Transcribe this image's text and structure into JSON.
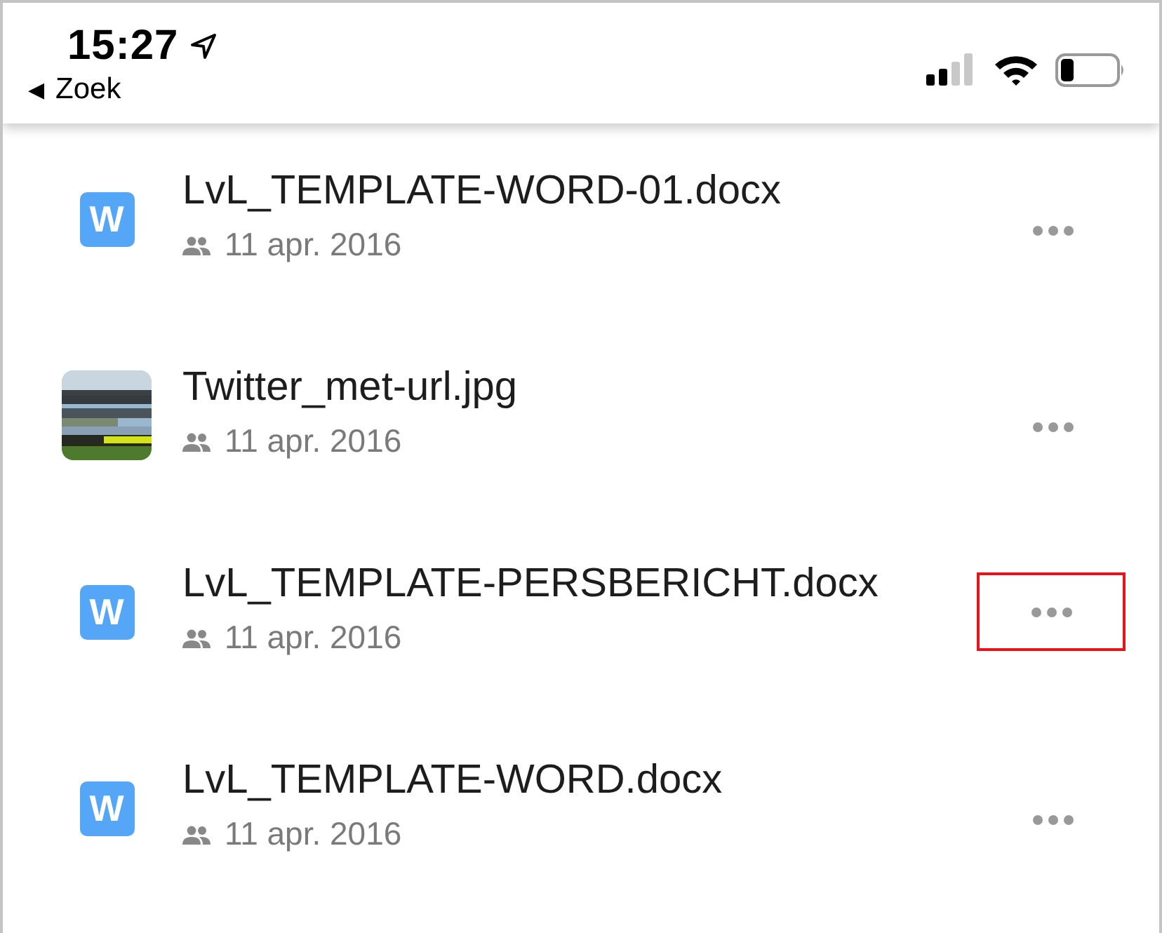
{
  "status_bar": {
    "time": "15:27",
    "back_label": "Zoek",
    "location_on": true,
    "back_arrow": "◀"
  },
  "files": [
    {
      "kind": "word",
      "icon_letter": "W",
      "name": "LvL_TEMPLATE-WORD-01.docx",
      "date": "11 apr. 2016",
      "shared": true,
      "highlighted": false
    },
    {
      "kind": "picture",
      "name": "Twitter_met-url.jpg",
      "date": "11 apr. 2016",
      "shared": true,
      "highlighted": false
    },
    {
      "kind": "word",
      "icon_letter": "W",
      "name": "LvL_TEMPLATE-PERSBERICHT.docx",
      "date": "11 apr. 2016",
      "shared": true,
      "highlighted": true
    },
    {
      "kind": "word",
      "icon_letter": "W",
      "name": "LvL_TEMPLATE-WORD.docx",
      "date": "11 apr. 2016",
      "shared": true,
      "highlighted": false
    }
  ]
}
